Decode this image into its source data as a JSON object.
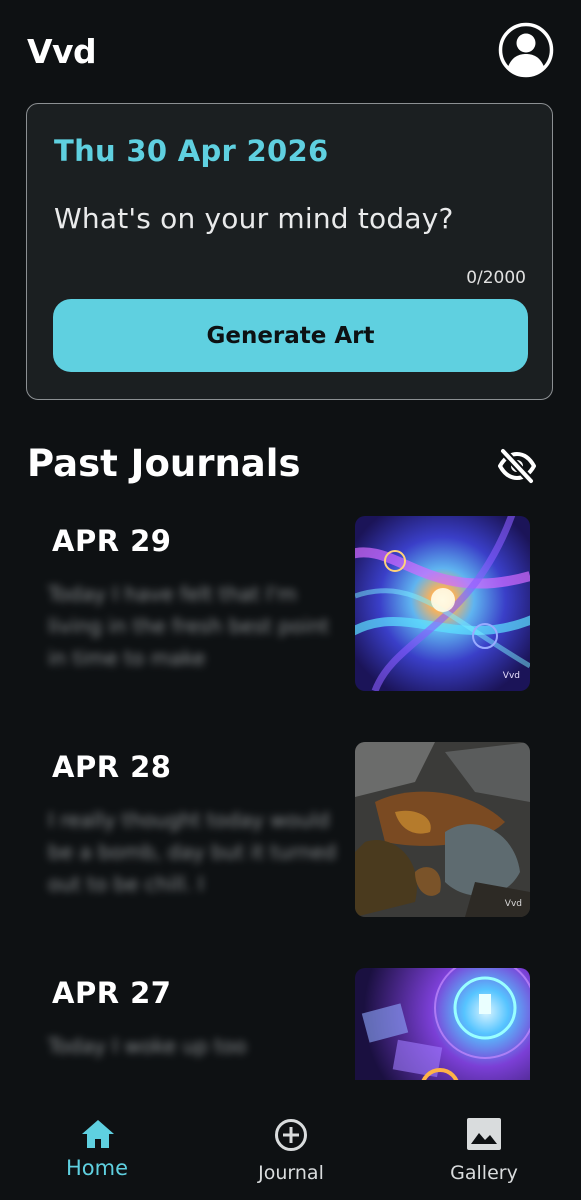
{
  "header": {
    "app_title": "Vvd"
  },
  "compose": {
    "date": "Thu 30 Apr 2026",
    "placeholder": "What's on your mind today?",
    "char_count": "0/2000",
    "generate_label": "Generate Art"
  },
  "past_journals": {
    "title": "Past Journals",
    "entries": [
      {
        "date": "APR 29",
        "preview": "Today I have felt that I'm living in the fresh best point in time to make",
        "thumb_watermark": "Vvd"
      },
      {
        "date": "APR 28",
        "preview": "I really thought today would be a bomb, day but it turned out to be chill. I",
        "thumb_watermark": "Vvd"
      },
      {
        "date": "APR 27",
        "preview": "Today I woke up too",
        "thumb_watermark": ""
      }
    ]
  },
  "nav": {
    "home_label": "Home",
    "journal_label": "Journal",
    "gallery_label": "Gallery"
  },
  "colors": {
    "accent": "#5fd0e0",
    "background": "#0e1113",
    "card": "#1b1f21"
  },
  "icons": [
    "profile-icon",
    "eye-off-icon",
    "home-icon",
    "add-circle-icon",
    "image-icon"
  ]
}
